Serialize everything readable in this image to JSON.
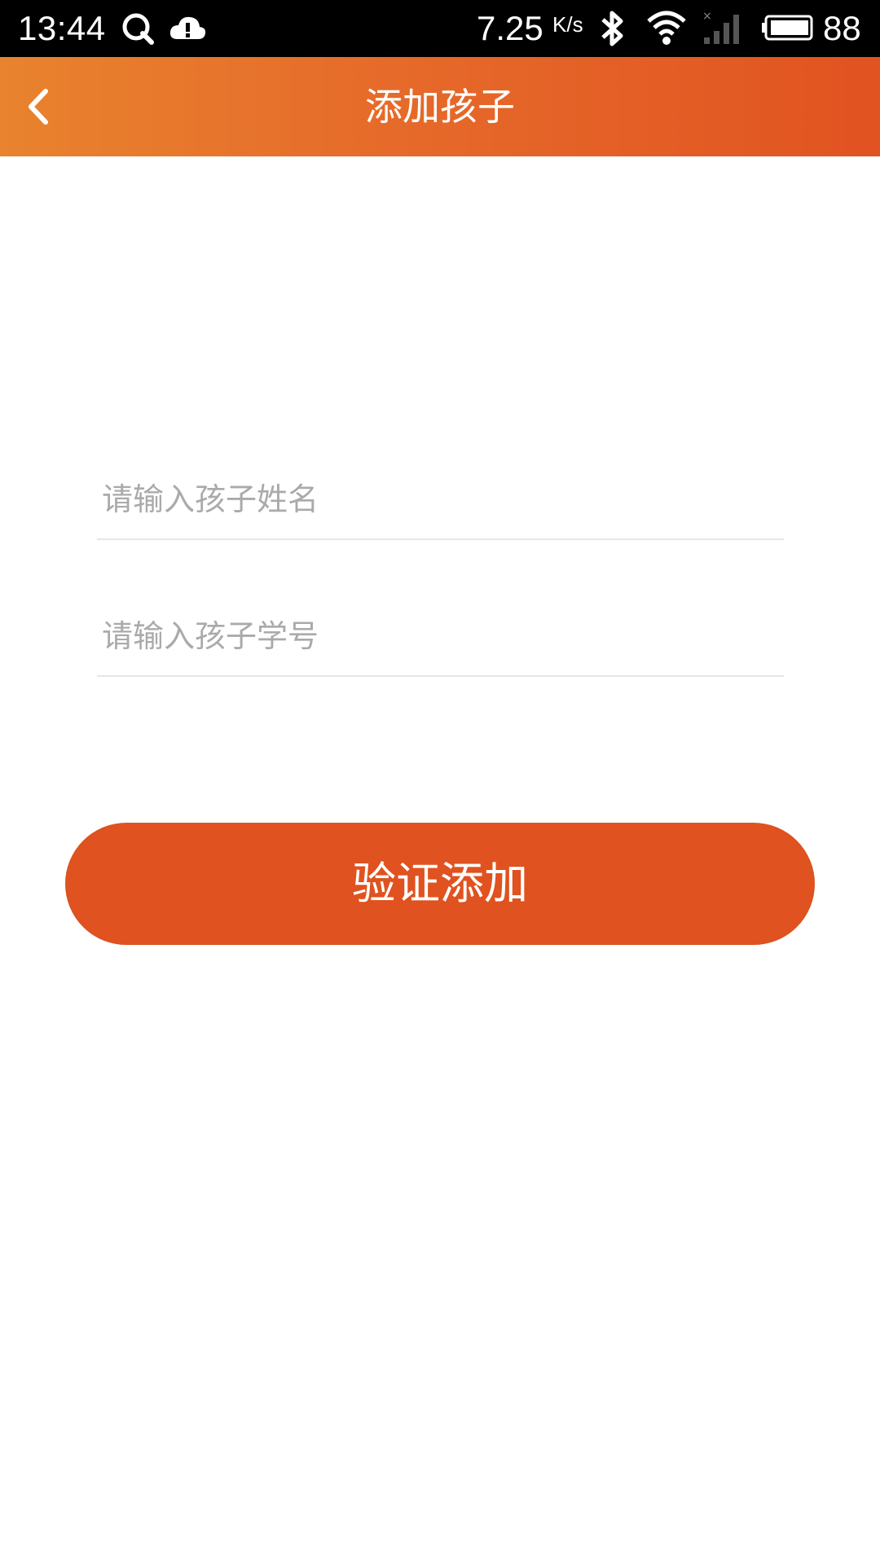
{
  "status_bar": {
    "time": "13:44",
    "net_speed_value": "7.25",
    "net_speed_unit": "K/s",
    "battery_level": "88",
    "icons": [
      "qq-icon",
      "cloud-alert-icon",
      "bluetooth-icon",
      "wifi-icon",
      "cellular-signal-icon",
      "battery-icon"
    ]
  },
  "header": {
    "title": "添加孩子",
    "background_start": "#e8832e",
    "background_end": "#e15321",
    "back_icon": "chevron-left-icon"
  },
  "form": {
    "name_field": {
      "value": "",
      "placeholder": "请输入孩子姓名"
    },
    "student_id_field": {
      "value": "",
      "placeholder": "请输入孩子学号"
    },
    "submit_label": "验证添加",
    "submit_color": "#e0521f"
  }
}
